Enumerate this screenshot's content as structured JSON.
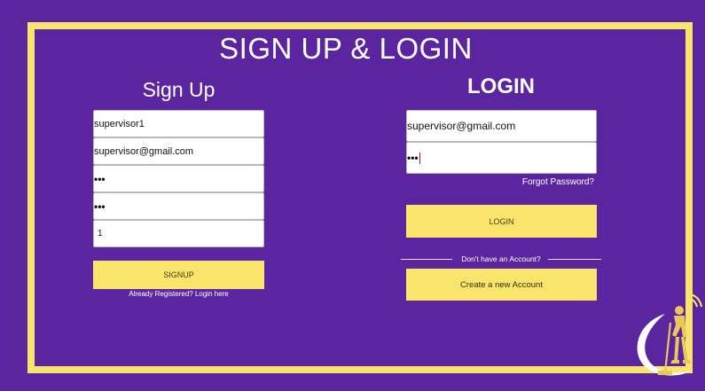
{
  "page": {
    "title": "SIGN UP & LOGIN"
  },
  "signup": {
    "title": "Sign Up",
    "username_value": "supervisor1",
    "email_value": "supervisor@gmail.com",
    "password_mask": "•••",
    "confirm_mask": "•••",
    "number_value": "1",
    "button_label": "SIGNUP",
    "already_registered": "Already Registered? Login here"
  },
  "login": {
    "title": "LOGIN",
    "email_value": "supervisor@gmail.com",
    "password_mask": "•••",
    "forgot_label": "Forgot Password?",
    "button_label": "LOGIN",
    "no_account_text": "Don't have an Account?",
    "create_account_label": "Create a new Account"
  },
  "theme": {
    "background": "#5a259e",
    "accent": "#f9e56c",
    "field_bg": "#ffffff",
    "caret": "#d0005a"
  },
  "icons": {
    "mascot": "cleaner-mopping-icon",
    "wifi": "wifi-signal-icon"
  }
}
